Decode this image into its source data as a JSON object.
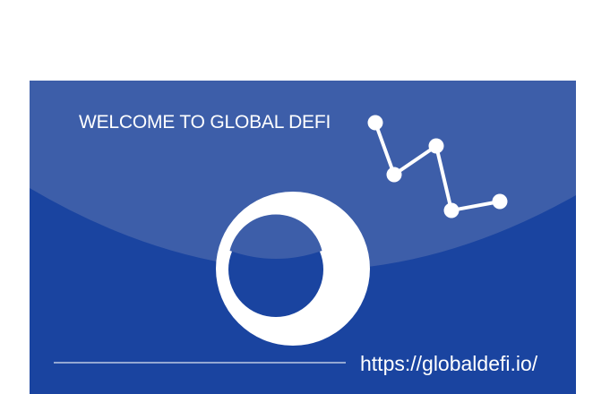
{
  "banner": {
    "welcome_text": "WELCOME TO GLOBAL DEFI",
    "url_text": "https://globaldefi.io/",
    "logo_icon": "ring-logo-icon",
    "chart_icon": "line-nodes-icon",
    "colors": {
      "background": "#1a44a0",
      "highlight": "#3d5ea9",
      "foreground": "#ffffff"
    }
  }
}
